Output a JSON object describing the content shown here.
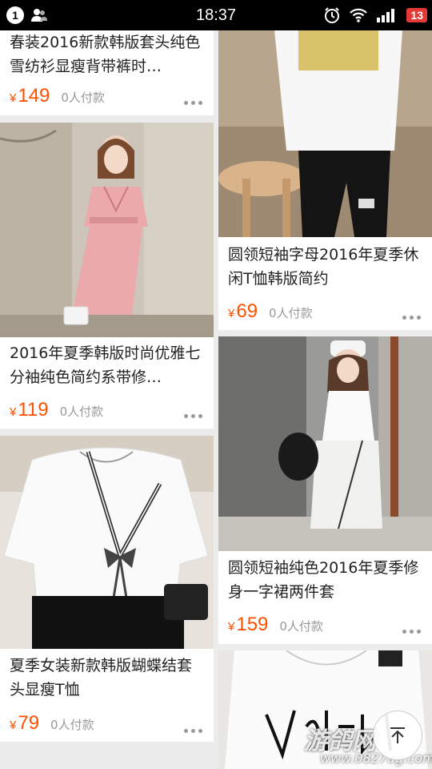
{
  "status_bar": {
    "notification_count": "1",
    "time": "18:37",
    "battery": "13"
  },
  "currency_symbol": "¥",
  "products": [
    {
      "title": "春装2016新款韩版套头纯色雪纺衫显瘦背带裤时…",
      "price": "149",
      "paid": "0人付款",
      "image": "pink-dress-photo"
    },
    {
      "title": "2016年夏季韩版时尚优雅七分袖纯色简约系带修…",
      "price": "119",
      "paid": "0人付款",
      "image": "pink-dress-photo"
    },
    {
      "title": "夏季女装新款韩版蝴蝶结套头显瘦T恤",
      "price": "79",
      "paid": "0人付款",
      "image": "white-bow-tshirt-photo"
    },
    {
      "title": "圆领短袖字母2016年夏季休闲T恤韩版简约",
      "price": "69",
      "paid": "0人付款",
      "image": "white-tshirt-black-pants-photo"
    },
    {
      "title": "圆领短袖纯色2016年夏季修身一字裙两件套",
      "price": "159",
      "paid": "0人付款",
      "image": "white-two-piece-photo"
    },
    {
      "title": "",
      "price": "",
      "paid": "",
      "image": "valentino-tshirt-photo"
    }
  ],
  "watermark": {
    "text": "游鸽网",
    "url": "www.0827ug.com"
  },
  "colors": {
    "price": "#ff5000",
    "meta_text": "#999999",
    "background": "#ececec"
  }
}
